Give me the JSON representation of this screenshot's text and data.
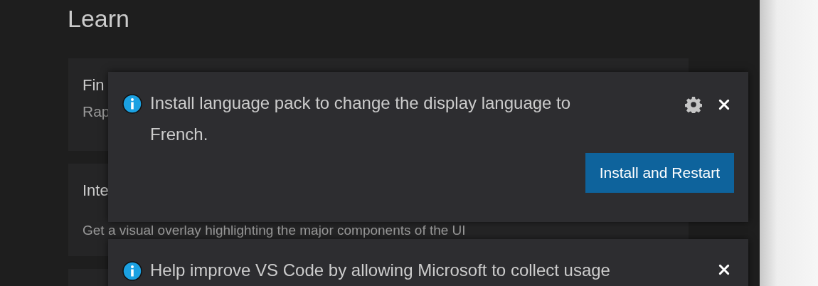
{
  "heading": "Learn",
  "cards": [
    {
      "title": "Fin",
      "description": "Rap"
    },
    {
      "title": "Inte",
      "description": "Get a visual overlay highlighting the major components of the UI"
    }
  ],
  "notifications": [
    {
      "message": "Install language pack to change the display language to French.",
      "has_settings": true,
      "actions": [
        "Install and Restart"
      ]
    },
    {
      "message": "Help improve VS Code by allowing Microsoft to collect usage",
      "has_settings": false
    }
  ]
}
